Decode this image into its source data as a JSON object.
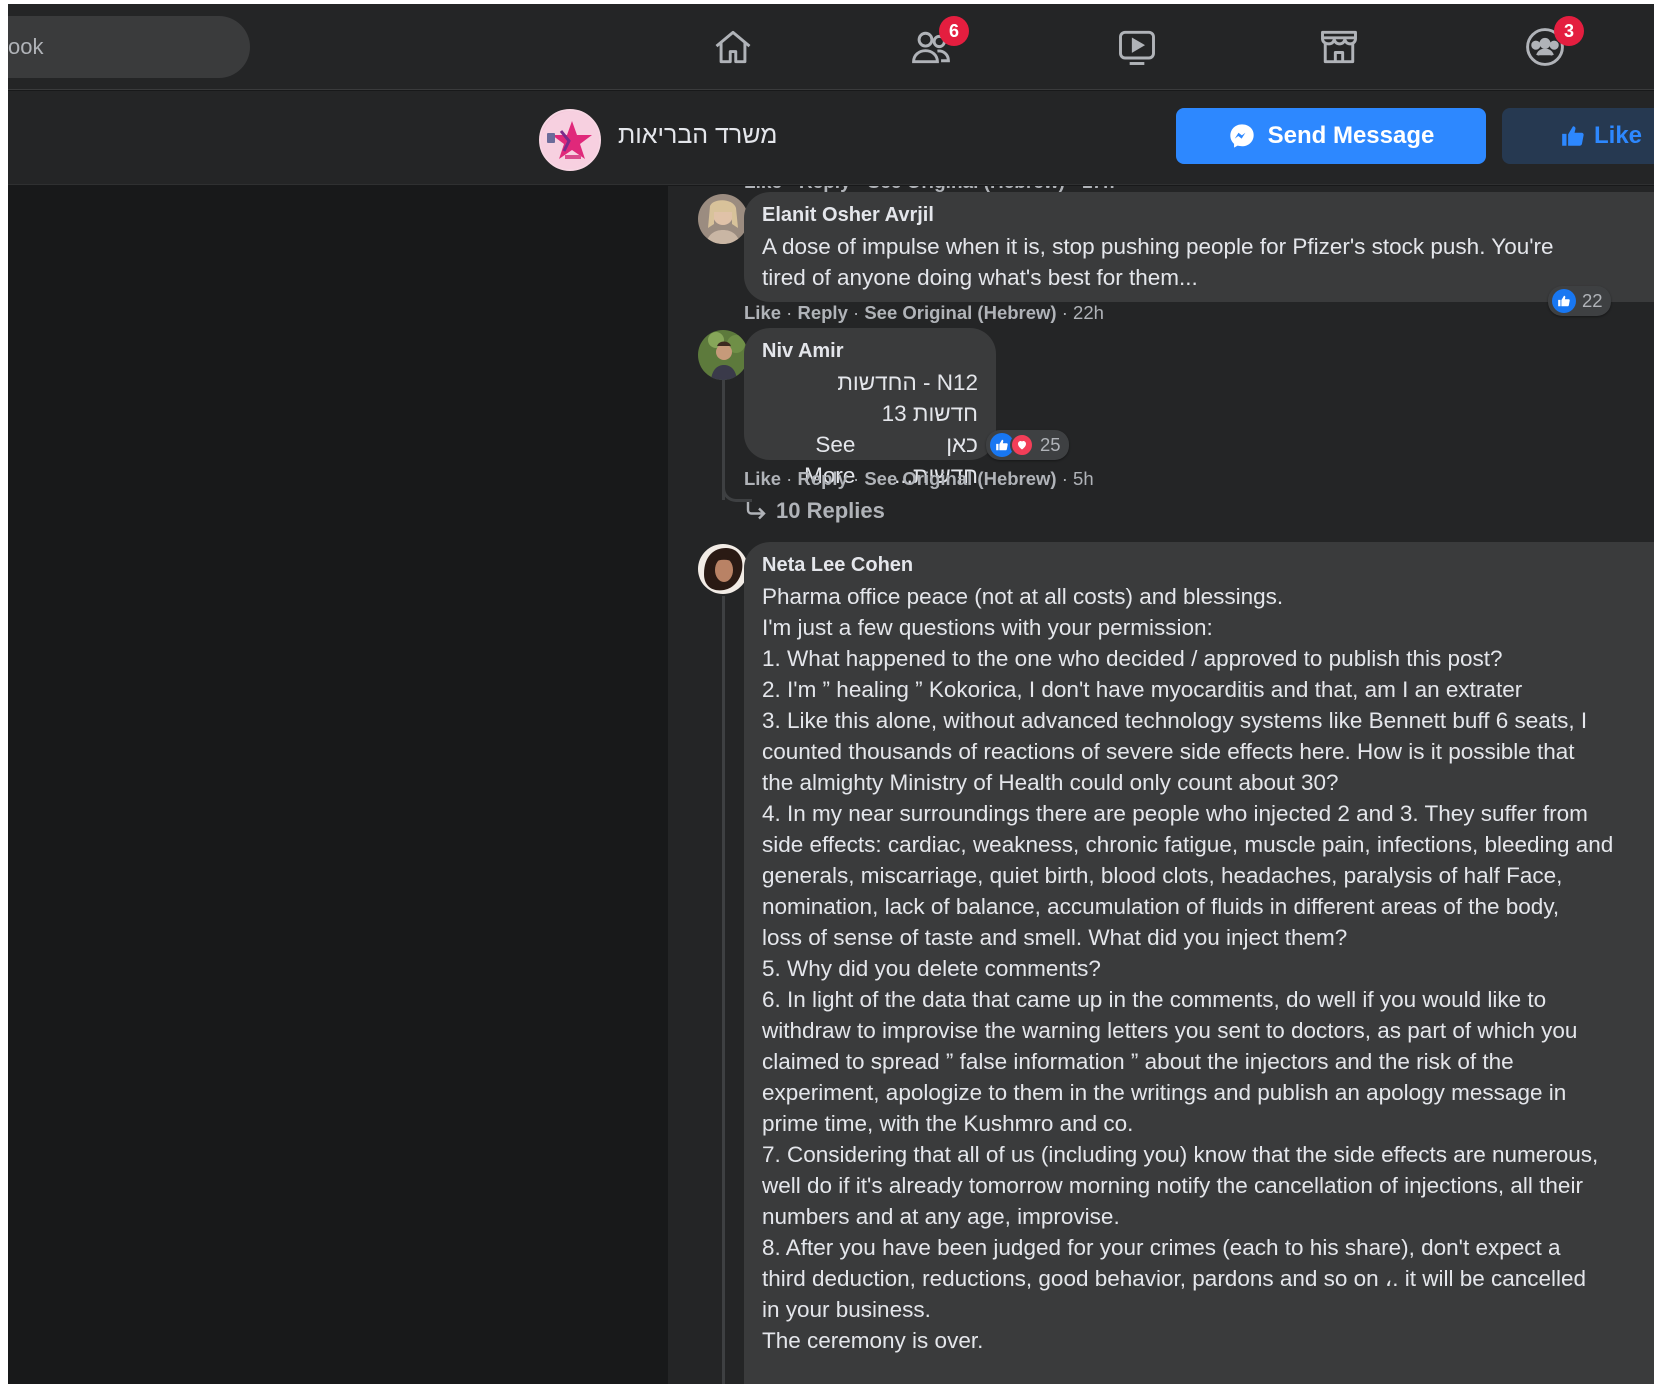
{
  "nav": {
    "search_text": "ook",
    "friends_badge": "6",
    "groups_badge": "3"
  },
  "page": {
    "name": "משרד הבריאות",
    "send_message_label": "Send Message",
    "like_label": "Like"
  },
  "comments": [
    {
      "author": "Elanit Osher Avrjil",
      "lines": [
        "A dose of impulse when it is, stop pushing people for Pfizer's stock push. You're",
        "tired of anyone doing what's best for them..."
      ],
      "actions": {
        "like": "Like",
        "reply": "Reply",
        "see_original": "See Original (Hebrew)",
        "time": "22h"
      },
      "reaction_count": "22"
    },
    {
      "author": "Niv Amir",
      "lines": [
        "N12 - החדשות",
        "חדשות 13",
        "כאן חדשות..."
      ],
      "see_more": "See More",
      "actions": {
        "like": "Like",
        "reply": "Reply",
        "see_original": "See Original (Hebrew)",
        "time": "5h"
      },
      "reaction_count": "25",
      "replies_label": "10 Replies"
    },
    {
      "author": "Neta Lee Cohen",
      "lines": [
        "Pharma office peace (not at all costs) and blessings.",
        "I'm just a few questions with your permission:",
        "1. What happened to the one who decided / approved to publish this post?",
        "2. I'm ” healing ” Kokorica, I don't have myocarditis and that, am I an extrater",
        "3. Like this alone, without advanced technology systems like Bennett buff 6 seats, I",
        "counted thousands of reactions of severe side effects here. How is it possible that",
        "the almighty Ministry of Health could only count about 30?",
        "4. In my near surroundings there are people who injected 2 and 3. They suffer from",
        "side effects: cardiac, weakness, chronic fatigue, muscle pain, infections, bleeding and",
        "generals, miscarriage, quiet birth, blood clots, headaches, paralysis of half Face,",
        "nomination, lack of balance, accumulation of fluids in different areas of the body,",
        "loss of sense of taste and smell. What did you inject them?",
        "5. Why did you delete comments?",
        "6. In light of the data that came up in the comments, do well if you would like to",
        "withdraw to improvise the warning letters you sent to doctors, as part of which you",
        "claimed to spread ” false information ” about the injectors and the risk of the",
        "experiment, apologize to them in the writings and publish an apology message in",
        "prime time, with the Kushmro and co.",
        "7. Considering that all of us (including you) know that the side effects are numerous,",
        "well do if it's already tomorrow morning notify the cancellation of injections, all their",
        "numbers and at any age, improvise.",
        "8. After you have been judged for your crimes (each to his share), don't expect a",
        "third deduction, reductions, good behavior, pardons and so on ،. it will be cancelled",
        "in your business.",
        "The ceremony is over."
      ]
    }
  ],
  "colors": {
    "background": "#18191a",
    "surface": "#242526",
    "bubble": "#3a3b3c",
    "accent": "#2d88ff",
    "badge": "#e41e3f"
  }
}
